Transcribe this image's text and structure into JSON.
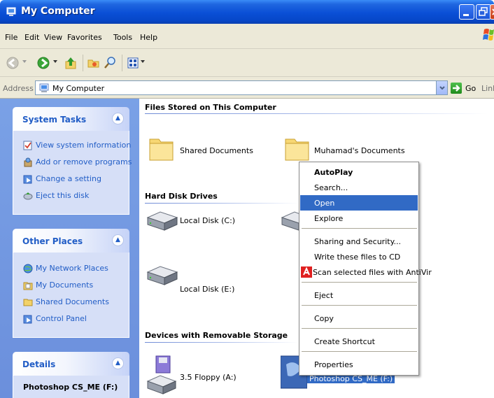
{
  "window": {
    "title": "My Computer"
  },
  "menubar": [
    "File",
    "Edit",
    "View",
    "Favorites",
    "Tools",
    "Help"
  ],
  "address": {
    "label": "Address",
    "value": "My Computer",
    "go": "Go",
    "links": "Links"
  },
  "system_tasks": {
    "title": "System Tasks",
    "items": [
      "View system information",
      "Add or remove programs",
      "Change a setting",
      "Eject this disk"
    ]
  },
  "other_places": {
    "title": "Other Places",
    "items": [
      "My Network Places",
      "My Documents",
      "Shared Documents",
      "Control Panel"
    ]
  },
  "details": {
    "title": "Details",
    "drive": "Photoshop CS_ME (F:)"
  },
  "groups": {
    "files_stored": "Files Stored on This Computer",
    "hard_disks": "Hard Disk Drives",
    "removable": "Devices with Removable Storage"
  },
  "items": {
    "shared_documents": "Shared Documents",
    "muhamads_documents": "Muhamad's Documents",
    "local_c": "Local Disk (C:)",
    "local_e": "Local Disk (E:)",
    "floppy": "3.5 Floppy (A:)",
    "photoshop_drive": "Photoshop CS_ME (F:)"
  },
  "context_menu": {
    "autoplay": "AutoPlay",
    "search": "Search...",
    "open": "Open",
    "explore": "Explore",
    "sharing": "Sharing and Security...",
    "write_cd": "Write these files to CD",
    "scan": "Scan selected files with AntiVir",
    "eject": "Eject",
    "copy": "Copy",
    "create_shortcut": "Create Shortcut",
    "properties": "Properties"
  },
  "colors": {
    "title_blue": "#0a4fd6",
    "task_link": "#215dc6",
    "menu_highlight": "#316ac5",
    "left_pane": "#7aa1e6"
  }
}
